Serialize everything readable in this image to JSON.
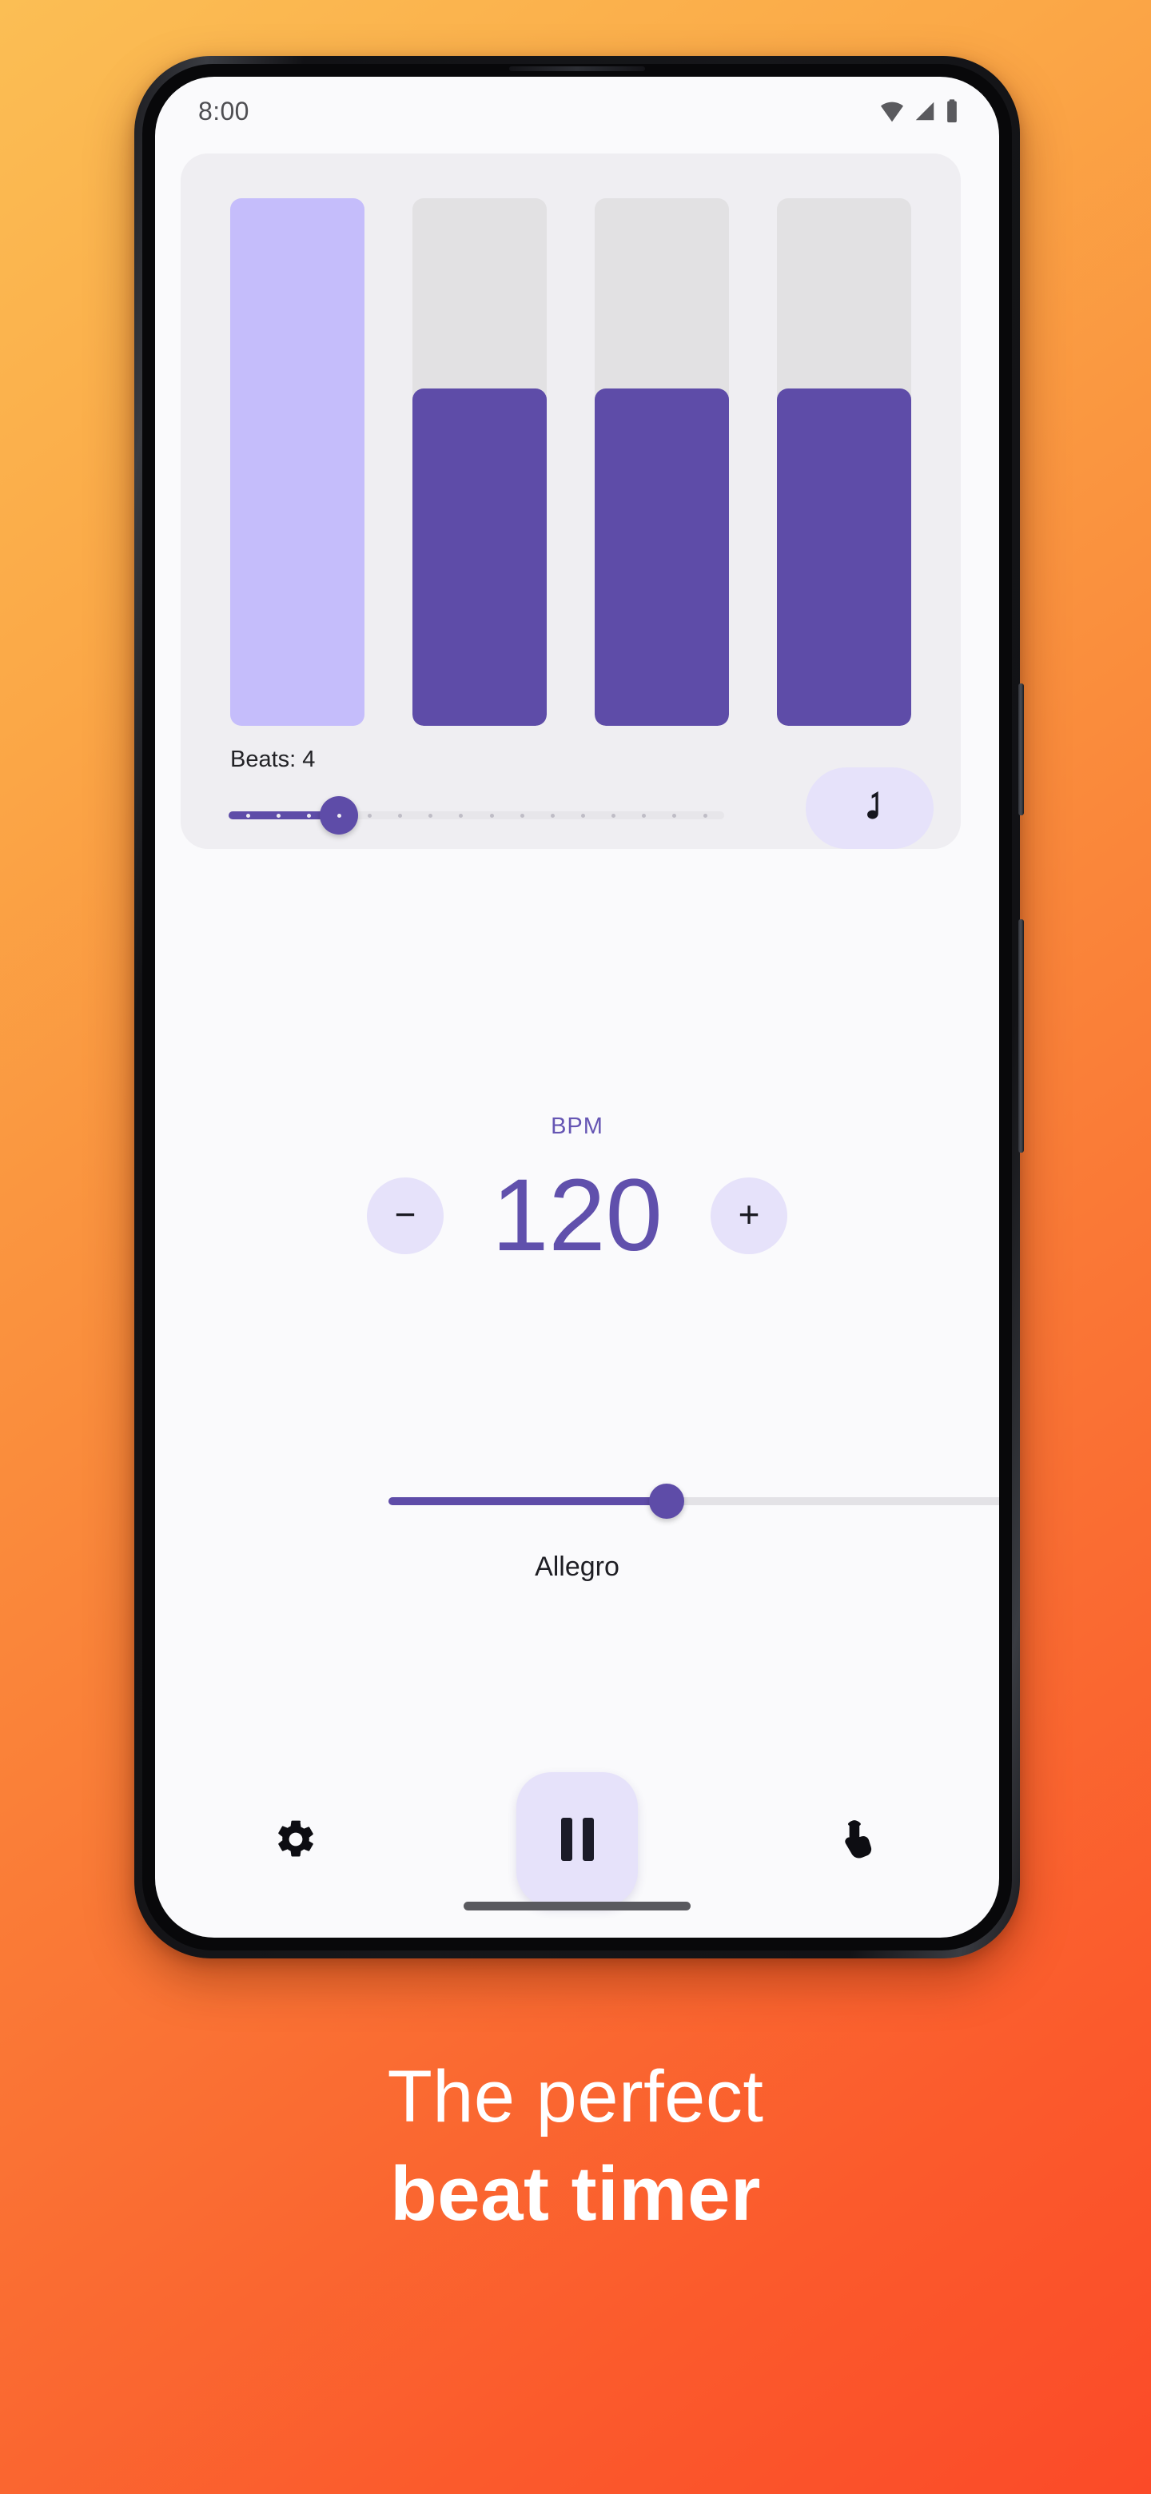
{
  "status_bar": {
    "time": "8:00",
    "icons": [
      "wifi-icon",
      "cell-signal-icon",
      "battery-icon"
    ]
  },
  "beats_card": {
    "label": "Beats: 4",
    "beats_count": 4,
    "current_beat": 1,
    "bars": [
      {
        "index": 1,
        "state": "active",
        "fill_percent": 100
      },
      {
        "index": 2,
        "state": "inactive",
        "fill_percent": 64
      },
      {
        "index": 3,
        "state": "inactive",
        "fill_percent": 64
      },
      {
        "index": 4,
        "state": "inactive",
        "fill_percent": 64
      }
    ],
    "slider": {
      "value": 4,
      "min": 1,
      "max": 16,
      "ticks": 16,
      "fill_percent": 20
    },
    "subdivision_button": {
      "icon": "music-note-icon",
      "label": "♩"
    }
  },
  "bpm_section": {
    "label": "BPM",
    "value": "120",
    "decrease_label": "−",
    "increase_label": "+",
    "slider": {
      "value": 120,
      "min": 40,
      "max": 240,
      "fill_percent": 37
    },
    "tempo_name": "Allegro"
  },
  "bottom_bar": {
    "settings_icon": "gear-icon",
    "play_state": "paused",
    "play_icon": "pause-icon",
    "tap_icon": "tap-tempo-icon"
  },
  "marketing": {
    "line1": "The perfect",
    "line2": "beat timer"
  },
  "colors": {
    "accent_purple": "#5E4CA8",
    "value_purple": "#6050AC",
    "light_lavender": "#E6E2FA",
    "active_bar": "#C5BDFB",
    "inactive_bar": "#E2E1E3",
    "card_bg": "#EFEEF2",
    "screen_bg": "#FAFAFC",
    "gradient_start": "#FBBE54",
    "gradient_end": "#FB4A28"
  }
}
